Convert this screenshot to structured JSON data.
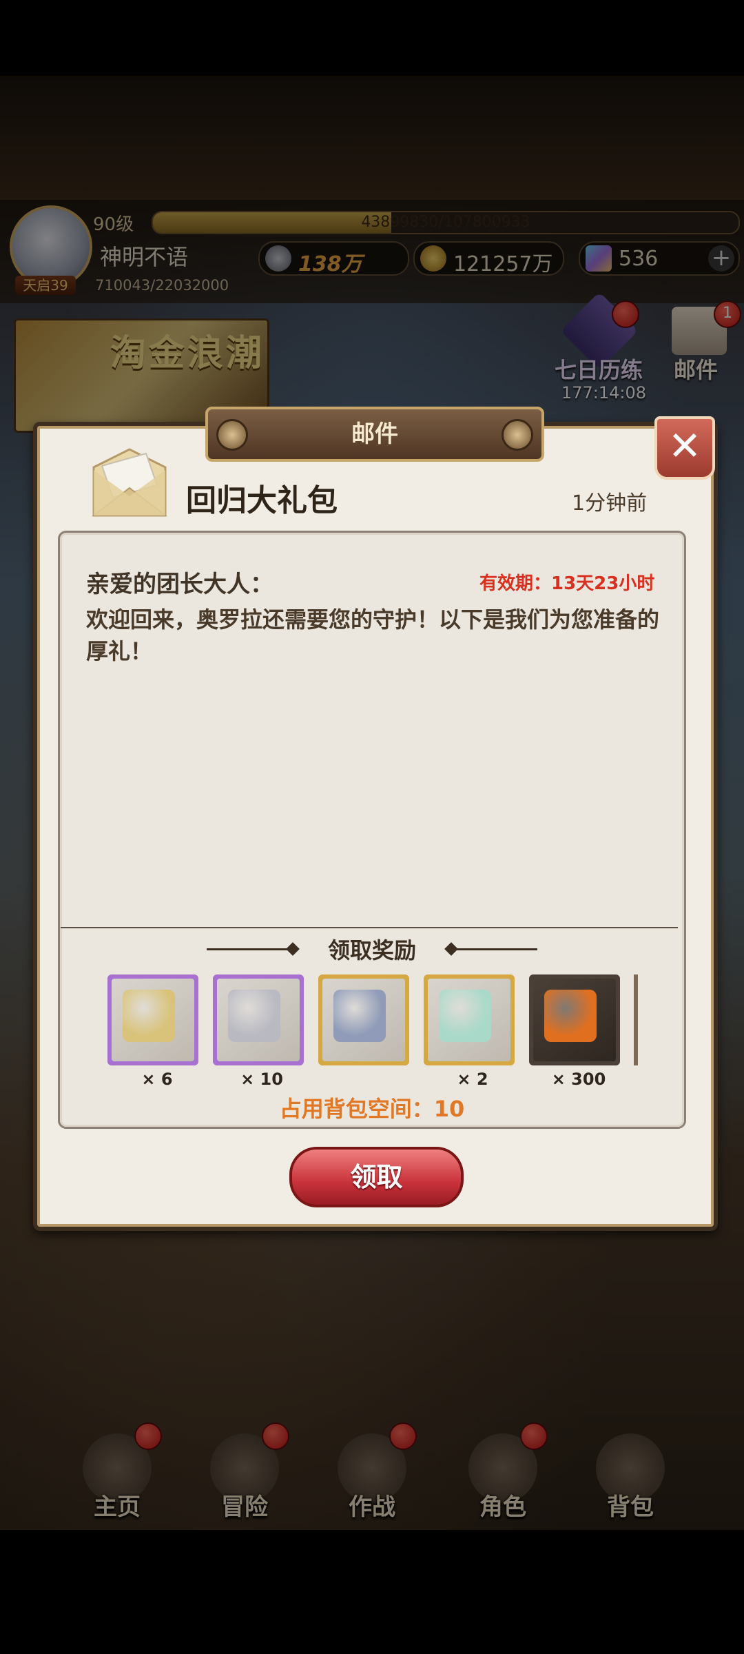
{
  "hud": {
    "level": "90级",
    "exp_text": "43899830/107800933",
    "exp_progress": 0.407,
    "player_name": "神明不语",
    "vip_badge": "天启39",
    "hp_text": "710043/22032000",
    "power": "138万",
    "gold": "121257万",
    "gems": "536",
    "plus": "+"
  },
  "event_banner": {
    "title": "淘金浪潮"
  },
  "side_buttons": {
    "seven_day": {
      "label": "七日历练",
      "timer": "177:14:08"
    },
    "mail": {
      "label": "邮件",
      "badge": "1"
    }
  },
  "dialog": {
    "title": "邮件",
    "close": "✕",
    "subject": "回归大礼包",
    "time_ago": "1分钟前",
    "salutation": "亲爱的团长大人：",
    "validity": "有效期：13天23小时",
    "body": "欢迎回来，奥罗拉还需要您的守护！以下是我们为您准备的厚礼！",
    "rewards_header": "领取奖励",
    "rewards": [
      {
        "icon": "map-compass-icon",
        "qty": "× 6",
        "frame": "#a870d0",
        "art": "#d9c37a"
      },
      {
        "icon": "stopwatch-icon",
        "qty": "× 10",
        "frame": "#a870d0",
        "art": "#b9b9c2"
      },
      {
        "icon": "armor-boots-icon",
        "qty": "",
        "frame": "#d4a843",
        "art": "#8f9bb8"
      },
      {
        "icon": "ticket-icon",
        "qty": "× 2",
        "frame": "#d4a843",
        "art": "#a9d9c9"
      },
      {
        "icon": "mystery-armor-icon",
        "qty": "× 300",
        "frame": "#4a4038",
        "art": "#e07020"
      }
    ],
    "bag_space": "占用背包空间：10",
    "claim_label": "领取"
  },
  "bottom_nav": [
    {
      "label": "主页",
      "icon": "castle-icon"
    },
    {
      "label": "冒险",
      "icon": "portal-icon"
    },
    {
      "label": "作战",
      "icon": "battle-icon"
    },
    {
      "label": "角色",
      "icon": "character-icon"
    },
    {
      "label": "背包",
      "icon": "bag-icon"
    }
  ]
}
